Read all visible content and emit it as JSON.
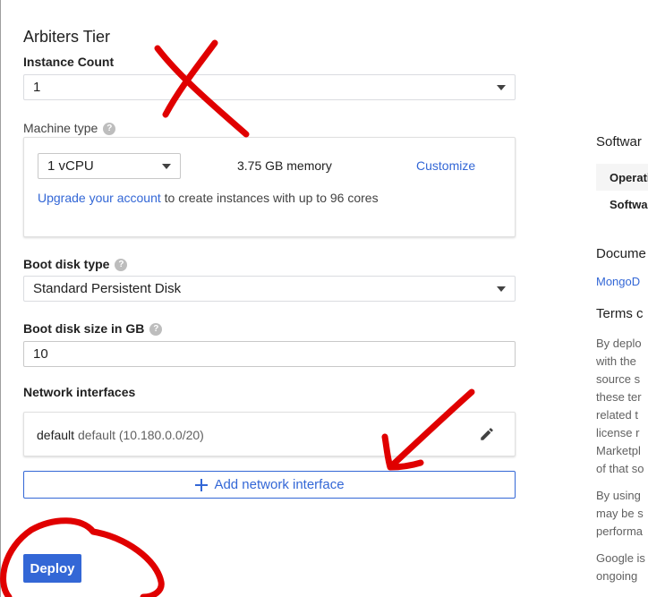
{
  "arbiters_tier": {
    "title": "Arbiters Tier",
    "instance_count_label": "Instance Count",
    "instance_count_value": "1"
  },
  "machine_type": {
    "label": "Machine type",
    "cpu_value": "1 vCPU",
    "memory": "3.75 GB memory",
    "customize_label": "Customize",
    "upgrade_link": "Upgrade your account",
    "upgrade_rest": " to create instances with up to 96 cores"
  },
  "boot_disk_type": {
    "label": "Boot disk type",
    "value": "Standard Persistent Disk"
  },
  "boot_disk_size": {
    "label": "Boot disk size in GB",
    "value": "10"
  },
  "network": {
    "label": "Network interfaces",
    "interface_name": "default",
    "interface_detail": "default (10.180.0.0/20)",
    "add_label": "Add network interface"
  },
  "deploy_label": "Deploy",
  "right_panel": {
    "software_heading": "Softwar",
    "row1": "Operati",
    "row2": "Softwa",
    "documentation_heading": "Docume",
    "doc_link": "MongoD",
    "terms_heading": "Terms c",
    "terms_lines": [
      "By deplo",
      "with the",
      "source s",
      "these ter",
      "related t",
      "license r",
      "Marketpl",
      "of that so"
    ],
    "using_lines": [
      "By using",
      "may be s",
      "performa"
    ],
    "google_lines": [
      "Google is",
      "ongoing"
    ]
  },
  "colors": {
    "accent": "#3367d6",
    "annotation": "#e00000"
  }
}
